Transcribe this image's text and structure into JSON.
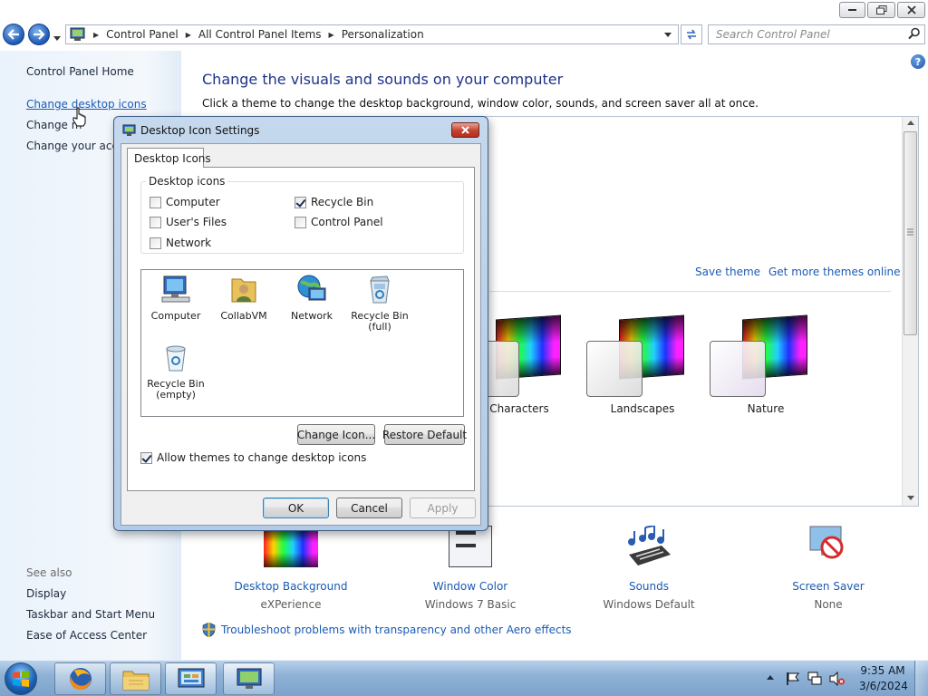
{
  "window": {
    "caption_buttons": [
      "minimize",
      "maximize",
      "close"
    ]
  },
  "address": {
    "crumbs": [
      "Control Panel",
      "All Control Panel Items",
      "Personalization"
    ],
    "search_placeholder": "Search Control Panel"
  },
  "left_pane": {
    "home": "Control Panel Home",
    "links": [
      "Change desktop icons",
      "Change mouse pointers",
      "Change your account picture"
    ],
    "links_visible": [
      "Change desktop icons",
      "Change m",
      "Change your acco"
    ],
    "see_also_label": "See also",
    "see_also": [
      "Display",
      "Taskbar and Start Menu",
      "Ease of Access Center"
    ]
  },
  "main": {
    "title": "Change the visuals and sounds on your computer",
    "description": "Click a theme to change the desktop background, window color, sounds, and screen saver all at once.",
    "save_theme": "Save theme",
    "get_more_themes": "Get more themes online",
    "themes": [
      {
        "label": "Characters"
      },
      {
        "label": "Landscapes"
      },
      {
        "label": "Nature"
      }
    ],
    "bottom": [
      {
        "title": "Desktop Background",
        "value": "eXPerience",
        "icon": "desktop-background-icon"
      },
      {
        "title": "Window Color",
        "value": "Windows 7 Basic",
        "icon": "window-color-icon"
      },
      {
        "title": "Sounds",
        "value": "Windows Default",
        "icon": "sounds-icon"
      },
      {
        "title": "Screen Saver",
        "value": "None",
        "icon": "screen-saver-icon"
      }
    ],
    "troubleshoot": "Troubleshoot problems with transparency and other Aero effects"
  },
  "dialog": {
    "title": "Desktop Icon Settings",
    "tab": "Desktop Icons",
    "group_label": "Desktop icons",
    "checkboxes": [
      {
        "label": "Computer",
        "checked": false
      },
      {
        "label": "Recycle Bin",
        "checked": true
      },
      {
        "label": "User's Files",
        "checked": false
      },
      {
        "label": "Control Panel",
        "checked": false
      },
      {
        "label": "Network",
        "checked": false
      }
    ],
    "icons": [
      {
        "label": "Computer",
        "icon": "computer-icon"
      },
      {
        "label": "CollabVM",
        "icon": "user-folder-icon"
      },
      {
        "label": "Network",
        "icon": "network-icon"
      },
      {
        "label": "Recycle Bin",
        "sub": "(full)",
        "icon": "recycle-bin-full-icon"
      },
      {
        "label": "Recycle Bin",
        "sub": "(empty)",
        "icon": "recycle-bin-empty-icon"
      }
    ],
    "change_icon": "Change Icon...",
    "restore_default": "Restore Default",
    "allow_themes": "Allow themes to change desktop icons",
    "allow_themes_checked": true,
    "ok": "OK",
    "cancel": "Cancel",
    "apply": "Apply"
  },
  "taskbar": {
    "items": [
      "firefox-icon",
      "explorer-icon",
      "control-panel-icon",
      "personalization-icon"
    ],
    "time": "9:35 AM",
    "date": "3/6/2024"
  }
}
